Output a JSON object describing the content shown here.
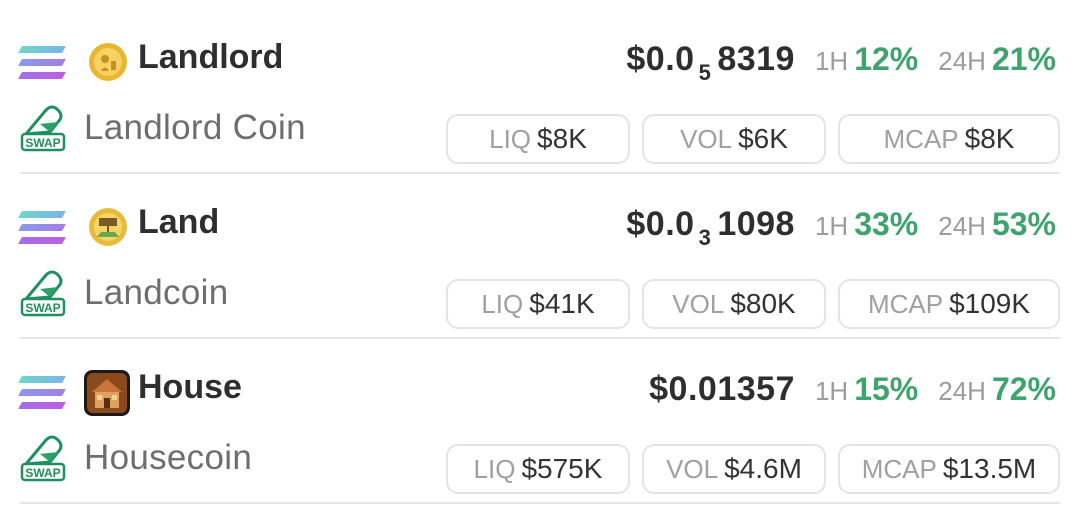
{
  "tokens": [
    {
      "symbol": "Landlord",
      "name": "Landlord Coin",
      "price_prefix": "$0.0",
      "price_zeros": "5",
      "price_digits": "8319",
      "h1_label": "1H",
      "h1_change": "12%",
      "h24_label": "24H",
      "h24_change": "21%",
      "liq_label": "LIQ",
      "liq_value": "$8K",
      "vol_label": "VOL",
      "vol_value": "$6K",
      "mcap_label": "MCAP",
      "mcap_value": "$8K",
      "logo_icon": "gold-coin-icon"
    },
    {
      "symbol": "Land",
      "name": "Landcoin",
      "price_prefix": "$0.0",
      "price_zeros": "3",
      "price_digits": "1098",
      "h1_label": "1H",
      "h1_change": "33%",
      "h24_label": "24H",
      "h24_change": "53%",
      "liq_label": "LIQ",
      "liq_value": "$41K",
      "vol_label": "VOL",
      "vol_value": "$80K",
      "mcap_label": "MCAP",
      "mcap_value": "$109K",
      "logo_icon": "land-sign-icon"
    },
    {
      "symbol": "House",
      "name": "Housecoin",
      "price_full": "$0.01357",
      "h1_label": "1H",
      "h1_change": "15%",
      "h24_label": "24H",
      "h24_change": "72%",
      "liq_label": "LIQ",
      "liq_value": "$575K",
      "vol_label": "VOL",
      "vol_value": "$4.6M",
      "mcap_label": "MCAP",
      "mcap_value": "$13.5M",
      "logo_icon": "house-icon"
    }
  ],
  "swap_badge_text": "SWAP",
  "chain_icon": "solana-icon",
  "colors": {
    "positive": "#3fa36d",
    "muted": "#9c9c9c",
    "divider": "#e6e6e6"
  }
}
